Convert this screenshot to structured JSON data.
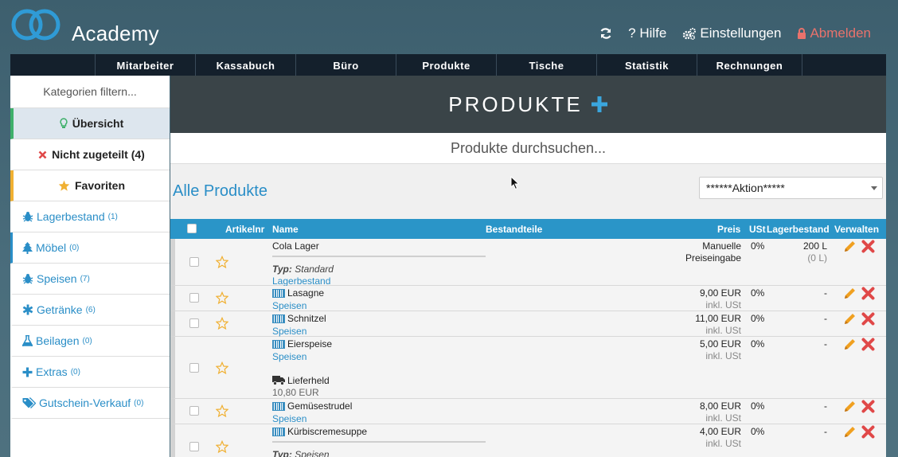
{
  "header": {
    "brand": "Academy",
    "refresh_label": "",
    "help_label": "? Hilfe",
    "settings_label": "Einstellungen",
    "logout_label": "Abmelden"
  },
  "nav": [
    "Mitarbeiter",
    "Kassabuch",
    "Büro",
    "Produkte",
    "Tische",
    "Statistik",
    "Rechnungen"
  ],
  "sidebar": {
    "filter_placeholder": "Kategorien filtern...",
    "overview": "Übersicht",
    "unassigned": "Nicht zugeteilt (4)",
    "favorites": "Favoriten",
    "categories": [
      {
        "label": "Lagerbestand",
        "count": "(1)",
        "icon": "bug-icon"
      },
      {
        "label": "Möbel",
        "count": "(0)",
        "icon": "tree-icon"
      },
      {
        "label": "Speisen",
        "count": "(7)",
        "icon": "bug-icon"
      },
      {
        "label": "Getränke",
        "count": "(6)",
        "icon": "asterisk-icon"
      },
      {
        "label": "Beilagen",
        "count": "(0)",
        "icon": "flask-icon"
      },
      {
        "label": "Extras",
        "count": "(0)",
        "icon": "plus-icon"
      },
      {
        "label": "Gutschein-Verkauf",
        "count": "(0)",
        "icon": "tags-icon"
      }
    ]
  },
  "main": {
    "title": "PRODUKTE",
    "search_placeholder": "Produkte durchsuchen...",
    "list_title": "Alle Produkte",
    "action_select": "******Aktion*****",
    "columns": {
      "artikelnr": "Artikelnr",
      "name": "Name",
      "bestandteile": "Bestandteile",
      "preis": "Preis",
      "ust": "USt",
      "lagerbestand": "Lagerbestand",
      "verwalten": "Verwalten"
    }
  },
  "products": [
    {
      "name": "Cola Lager",
      "typ_label": "Typ:",
      "typ_value": "Standard",
      "category": "Lagerbestand",
      "price": "Manuelle",
      "price_note": "Preiseingabe",
      "vat": "0%",
      "stock": "200 L",
      "stock_note": "(0 L)"
    },
    {
      "name": "Lasagne",
      "category": "Speisen",
      "price": "9,00 EUR",
      "price_note": "inkl. USt",
      "vat": "0%",
      "stock": "-"
    },
    {
      "name": "Schnitzel",
      "category": "Speisen",
      "price": "11,00 EUR",
      "price_note": "inkl. USt",
      "vat": "0%",
      "stock": "-"
    },
    {
      "name": "Eierspeise",
      "category": "Speisen",
      "price": "5,00 EUR",
      "price_note": "inkl. USt",
      "vat": "0%",
      "stock": "-",
      "delivery_name": "Lieferheld",
      "delivery_price": "10,80 EUR"
    },
    {
      "name": "Gemüsestrudel",
      "category": "Speisen",
      "price": "8,00 EUR",
      "price_note": "inkl. USt",
      "vat": "0%",
      "stock": "-"
    },
    {
      "name": "Kürbiscremesuppe",
      "typ_label": "Typ:",
      "typ_value": "Speisen",
      "price": "4,00 EUR",
      "price_note": "inkl. USt",
      "vat": "0%",
      "stock": "-"
    }
  ],
  "colors": {
    "accent": "#2a95c8",
    "nav_bg": "#14202c",
    "delete": "#e04848",
    "edit": "#f0a020",
    "star": "#f0b032",
    "logout": "#e8726c"
  }
}
